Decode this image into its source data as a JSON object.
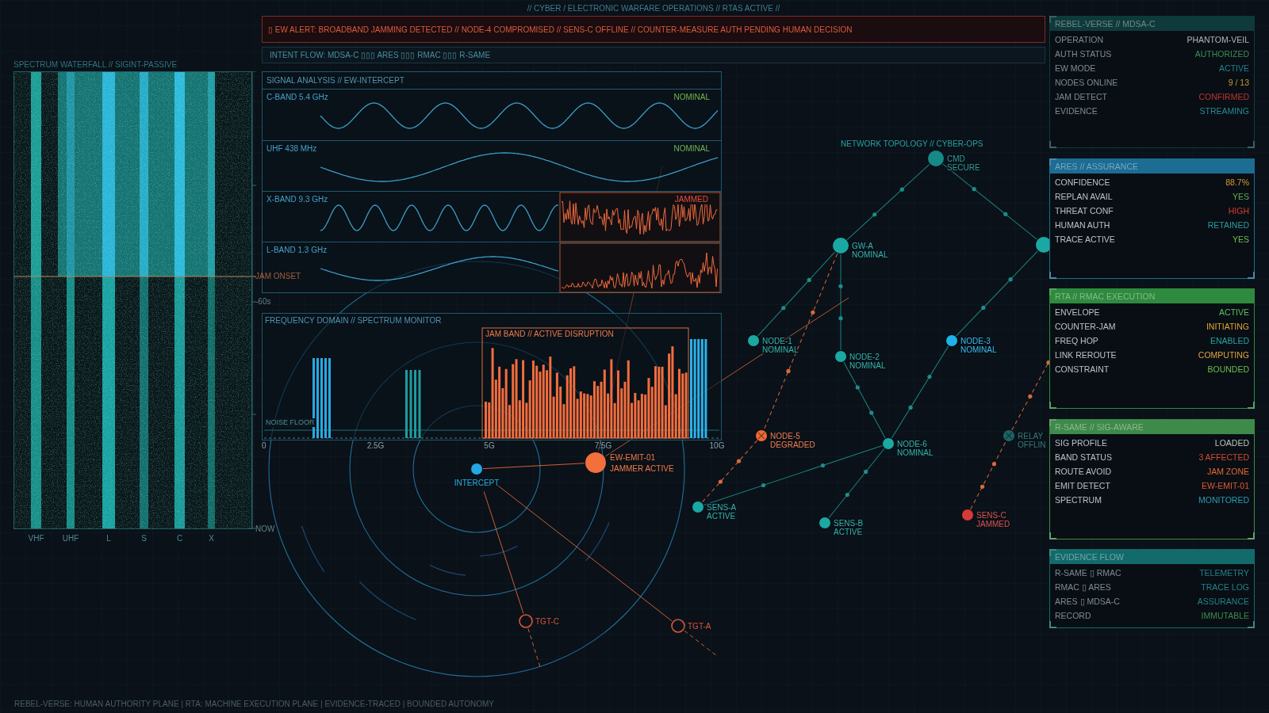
{
  "header": {
    "title": "// CYBER / ELECTRONIC WARFARE OPERATIONS // RTAS ACTIVE //"
  },
  "alert": {
    "text": "▯ EW ALERT: BROADBAND JAMMING DETECTED // NODE-4 COMPROMISED // SENS-C OFFLINE // COUNTER-MEASURE AUTH PENDING HUMAN DECISION"
  },
  "intent_flow": {
    "text": "INTENT FLOW: MDSA-C ▯▯▯ ARES ▯▯▯ RMAC ▯▯▯ R-SAME"
  },
  "waterfall": {
    "title": "SPECTRUM WATERFALL // SIGINT-PASSIVE",
    "bands": [
      "VHF",
      "UHF",
      "L",
      "S",
      "C",
      "X"
    ],
    "time_axis": [
      {
        "label": "JAM ONSET",
        "kind": "event"
      },
      {
        "label": "-60s",
        "kind": "tick"
      },
      {
        "label": "NOW",
        "kind": "tick"
      }
    ]
  },
  "signal_analysis": {
    "title": "SIGNAL ANALYSIS // EW-INTERCEPT",
    "rows": [
      {
        "label": "C-BAND 5.4 GHz",
        "status": "NOMINAL",
        "jammed": false
      },
      {
        "label": "UHF 438 MHz",
        "status": "NOMINAL",
        "jammed": false
      },
      {
        "label": "X-BAND 9.3 GHz",
        "status": "JAMMED",
        "jammed": true
      },
      {
        "label": "L-BAND 1.3 GHz",
        "jammed": true
      }
    ]
  },
  "spectrum": {
    "title": "FREQUENCY DOMAIN // SPECTRUM MONITOR",
    "noise_floor_label": "NOISE FLOOR",
    "jam_band_label": "JAM BAND // ACTIVE DISRUPTION",
    "x_ticks": [
      "0",
      "2.5G",
      "5G",
      "7.5G",
      "10G"
    ]
  },
  "radar": {
    "contacts": [
      {
        "kind": "intercept",
        "label": "INTERCEPT"
      },
      {
        "kind": "emitter",
        "label": "EW-EMIT-01",
        "status": "JAMMER ACTIVE"
      },
      {
        "kind": "target",
        "label": "TGT-C"
      },
      {
        "kind": "target",
        "label": "TGT-A"
      }
    ]
  },
  "topology": {
    "title": "NETWORK TOPOLOGY // CYBER-OPS",
    "nodes": [
      {
        "name": "CMD",
        "status": "SECURE",
        "kind": "hub",
        "color": "#168a86",
        "fault": false
      },
      {
        "name": "GW-A",
        "status": "NOMINAL",
        "kind": "hub",
        "color": "#1ba8a3",
        "fault": false
      },
      {
        "kind": "hub",
        "color": "#1ba8a3",
        "fault": false
      },
      {
        "name": "NODE-1",
        "status": "NOMINAL",
        "kind": "node",
        "color": "#1ba8a3",
        "fault": false
      },
      {
        "name": "NODE-2",
        "status": "NOMINAL",
        "kind": "node",
        "color": "#1ba8a3",
        "fault": false
      },
      {
        "name": "NODE-3",
        "status": "NOMINAL",
        "kind": "node",
        "color": "#1eb2ea",
        "fault": false
      },
      {
        "name": "NODE-5",
        "status": "DEGRADED",
        "kind": "node",
        "color": "#f26a35",
        "fault": true
      },
      {
        "name": "RELAY",
        "status": "OFFLIN",
        "kind": "node",
        "color": "#1d6466",
        "fault": true
      },
      {
        "name": "NODE-6",
        "status": "NOMINAL",
        "kind": "node",
        "color": "#1ba8a3",
        "fault": false
      },
      {
        "name": "SENS-A",
        "status": "ACTIVE",
        "kind": "node",
        "color": "#1ba8a3",
        "fault": false
      },
      {
        "name": "SENS-B",
        "status": "ACTIVE",
        "kind": "node",
        "color": "#1ba8a3",
        "fault": false
      },
      {
        "name": "SENS-C",
        "status": "JAMMED",
        "kind": "node",
        "color": "#d63a36",
        "fault": false
      }
    ]
  },
  "panels": [
    {
      "title": "REBEL-VERSE // MDSA-C",
      "color": "#0f3a3c",
      "dimmed": true,
      "rows": [
        {
          "label": "OPERATION",
          "value": "PHANTOM-VEIL",
          "color": "#aeb6b8"
        },
        {
          "label": "AUTH STATUS",
          "value": "AUTHORIZED",
          "color": "#3d8c55"
        },
        {
          "label": "EW MODE",
          "value": "ACTIVE",
          "color": "#22808c"
        },
        {
          "label": "NODES ONLINE",
          "value": "9 / 13",
          "color": "#c9952f"
        },
        {
          "label": "JAM DETECT",
          "value": "CONFIRMED",
          "color": "#b8352f"
        },
        {
          "label": "EVIDENCE",
          "value": "STREAMING",
          "color": "#2a8890"
        }
      ]
    },
    {
      "title": "ARES // ASSURANCE",
      "color": "#1c6c93",
      "dimmed": false,
      "rows": [
        {
          "label": "CONFIDENCE",
          "value": "88.7%",
          "color": "#d49a34"
        },
        {
          "label": "REPLAN AVAIL",
          "value": "YES",
          "color": "#5fb04a"
        },
        {
          "label": "THREAT CONF",
          "value": "HIGH",
          "color": "#d6392f"
        },
        {
          "label": "HUMAN AUTH",
          "value": "RETAINED",
          "color": "#2b9c9e"
        },
        {
          "label": "TRACE ACTIVE",
          "value": "YES",
          "color": "#6cc04c"
        }
      ]
    },
    {
      "title": "RTA // RMAC EXECUTION",
      "color": "#2e8a3e",
      "dimmed": false,
      "rows": [
        {
          "label": "ENVELOPE",
          "value": "ACTIVE",
          "color": "#5fbf5f"
        },
        {
          "label": "COUNTER-JAM",
          "value": "INITIATING",
          "color": "#e2a232"
        },
        {
          "label": "FREQ HOP",
          "value": "ENABLED",
          "color": "#2aa3a3"
        },
        {
          "label": "LINK REROUTE",
          "value": "COMPUTING",
          "color": "#e0a43a"
        },
        {
          "label": "CONSTRAINT",
          "value": "BOUNDED",
          "color": "#6cbf4c"
        }
      ]
    },
    {
      "title": "R-SAME // SIG-AWARE",
      "color": "#3e8a48",
      "dimmed": false,
      "rows": [
        {
          "label": "SIG PROFILE",
          "value": "LOADED",
          "color": "#b9c6b9"
        },
        {
          "label": "BAND STATUS",
          "value": "3 AFFECTED",
          "color": "#d04a32"
        },
        {
          "label": "ROUTE AVOID",
          "value": "JAM ZONE",
          "color": "#e8682e"
        },
        {
          "label": "EMIT DETECT",
          "value": "EW-EMIT-01",
          "color": "#e0572f"
        },
        {
          "label": "SPECTRUM",
          "value": "MONITORED",
          "color": "#2a9cb2"
        }
      ]
    },
    {
      "title": "EVIDENCE FLOW",
      "color": "#136a6b",
      "dimmed": true,
      "rows": [
        {
          "label": "R-SAME ▯ RMAC",
          "value": "TELEMETRY",
          "color": "#24808a"
        },
        {
          "label": "RMAC ▯ ARES",
          "value": "TRACE LOG",
          "color": "#23818a"
        },
        {
          "label": "ARES ▯ MDSA-C",
          "value": "ASSURANCE",
          "color": "#22828b"
        },
        {
          "label": "RECORD",
          "value": "IMMUTABLE",
          "color": "#3f8a4f"
        }
      ]
    }
  ],
  "footer": {
    "text": "REBEL-VERSE: HUMAN AUTHORITY PLANE | RTA: MACHINE EXECUTION PLANE | EVIDENCE-TRACED | BOUNDED AUTONOMY"
  }
}
